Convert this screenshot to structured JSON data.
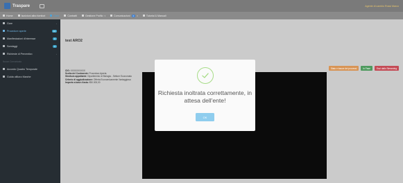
{
  "header": {
    "app_name": "Traspare",
    "user_name": "Agente di cambio Rossi Marco"
  },
  "nav": {
    "items": [
      {
        "label": "Home",
        "icon": "home-icon",
        "active": false
      },
      {
        "label": "Iscrizioni albo fornitori",
        "icon": "pencil-icon",
        "active": false
      },
      {
        "label": "Gare",
        "icon": "gavel-icon",
        "active": true
      },
      {
        "label": "Contratti",
        "icon": "table-icon",
        "active": false
      },
      {
        "label": "Gestione Profilo",
        "icon": "user-icon",
        "active": false,
        "caret": "▾"
      },
      {
        "label": "Comunicazioni",
        "icon": "megaphone-icon",
        "active": false,
        "badge": "0",
        "caret": "▾"
      },
      {
        "label": "Tutorial & Manuali",
        "icon": "video-icon",
        "active": false
      }
    ]
  },
  "sidebar": {
    "items": [
      {
        "label": "Gare",
        "icon": "gavel-icon",
        "caret": "‹"
      },
      {
        "label": "Procedure aperte",
        "icon": "check-icon",
        "badge": "10",
        "selected": true
      },
      {
        "label": "Manifestazioni d'interesse",
        "icon": "flag-icon",
        "badge": "0"
      },
      {
        "label": "Sondaggi",
        "icon": "chat-icon",
        "badge": "0"
      },
      {
        "label": "Richieste di Preventivo",
        "icon": "inbox-icon",
        "caret": "‹"
      },
      {
        "label": "Nuovo Comunicato",
        "header": true
      },
      {
        "label": "Accordo Quadro Temporale",
        "icon": "pencil-icon"
      },
      {
        "label": "Guida utilizzo Marche",
        "icon": "info-icon"
      }
    ]
  },
  "main": {
    "page_title": "test ARO2",
    "details": [
      {
        "label": "CIG:",
        "value": "XXXXXXXXXX"
      },
      {
        "label": "Scelta del Contraente:",
        "value": "Procedura Aperta"
      },
      {
        "label": "Struttura appaltante:",
        "value": "Dipartimento di Biologia - Settore Economato"
      },
      {
        "label": "Criterio di aggiudicazione:",
        "value": "Offerta Economicamente Vantaggiosa"
      },
      {
        "label": "Importo a base d'asta:",
        "value": "€50.000,00"
      }
    ],
    "actions": [
      {
        "label": "Stato e tracce dei processi",
        "style": "orange"
      },
      {
        "label": "In Fase",
        "style": "green"
      },
      {
        "label": "Esci dallo Streaming",
        "style": "red"
      }
    ]
  },
  "modal": {
    "message": "Richiesta inoltrata correttamente, in attesa dell'ente!",
    "ok_label": "OK",
    "icon": "check-circle-icon",
    "accent_color": "#a6dc86",
    "button_color": "#8fcdee"
  }
}
